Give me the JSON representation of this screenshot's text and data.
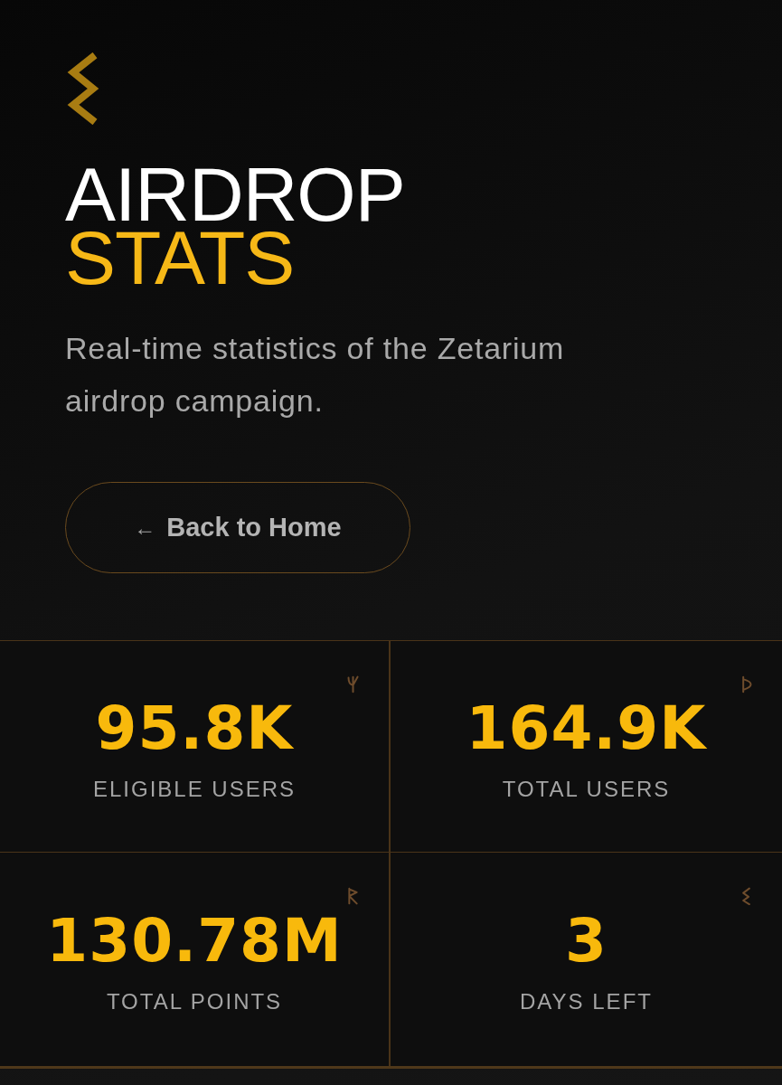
{
  "hero": {
    "title_line_1": "AIRDROP",
    "title_line_2": "STATS",
    "description": "Real-time statistics of the Zetarium airdrop campaign."
  },
  "back_button": {
    "arrow": "←",
    "label": "Back to Home"
  },
  "stats": [
    {
      "value": "95.8K",
      "label": "ELIGIBLE USERS"
    },
    {
      "value": "164.9K",
      "label": "TOTAL USERS"
    },
    {
      "value": "130.78M",
      "label": "TOTAL POINTS"
    },
    {
      "value": "3",
      "label": "DAYS LEFT"
    }
  ]
}
